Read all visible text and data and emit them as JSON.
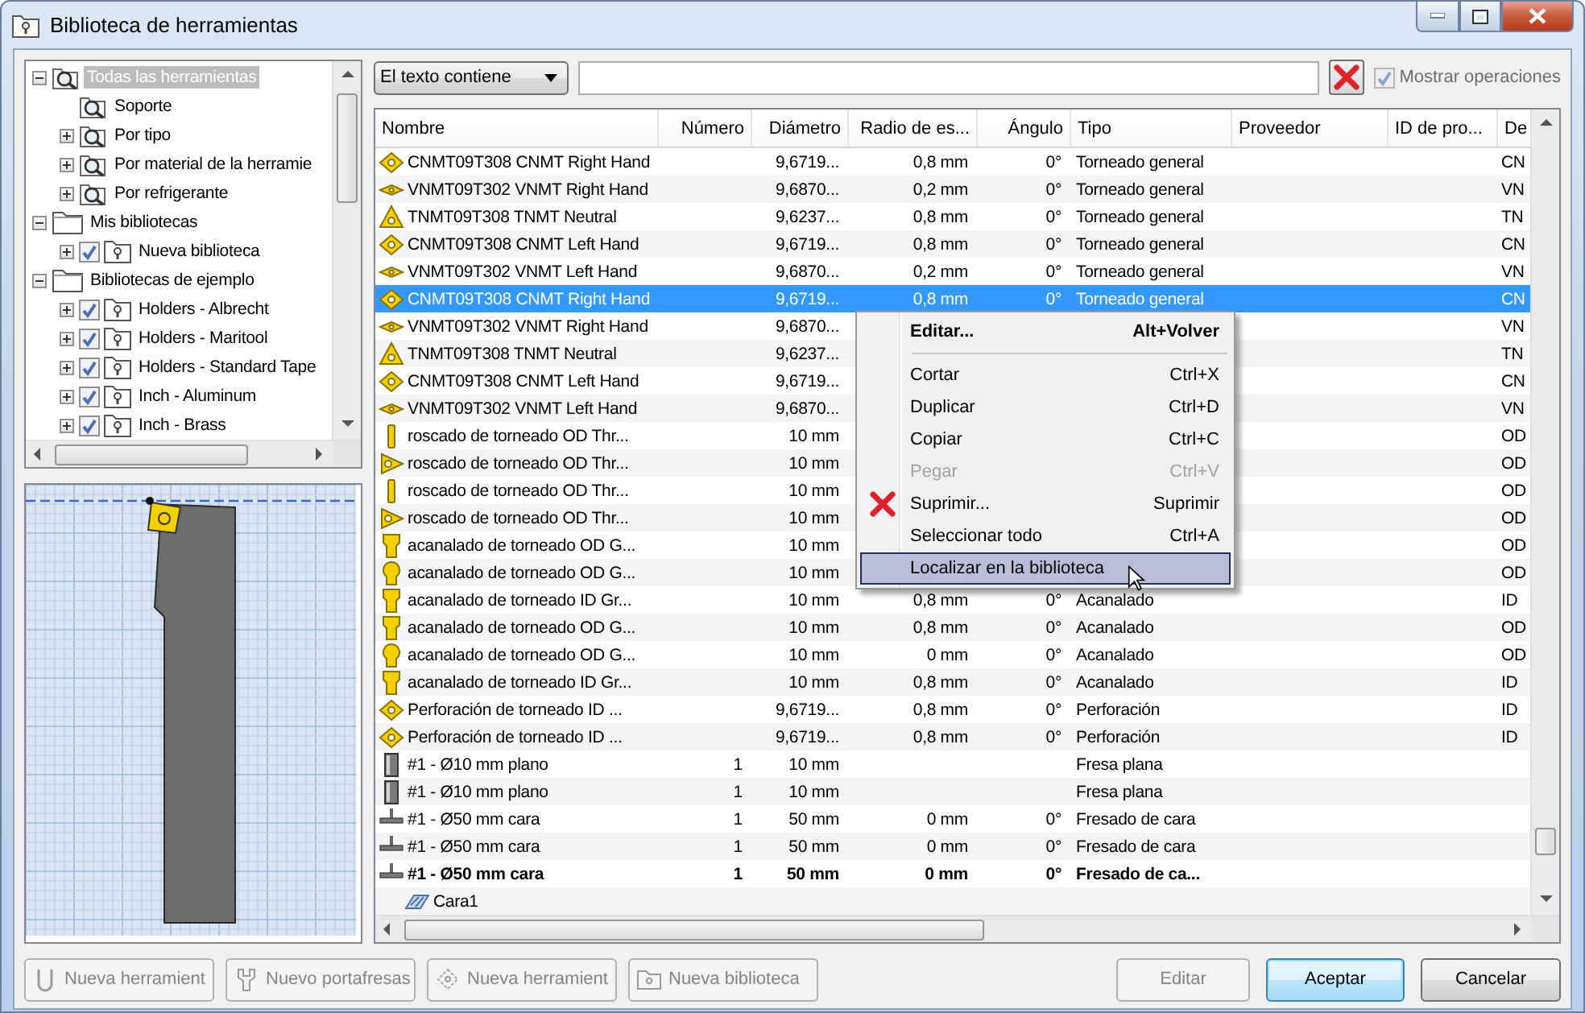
{
  "window": {
    "title": "Biblioteca de herramientas"
  },
  "tree": {
    "items": [
      {
        "label": "Todas las herramientas",
        "kind": "search",
        "selected": true,
        "expanded": true,
        "children": [
          {
            "label": "Soporte",
            "kind": "search",
            "selected": false
          },
          {
            "label": "Por tipo",
            "kind": "search",
            "selected": false,
            "expanded": false
          },
          {
            "label": "Por material de la herramie",
            "kind": "search",
            "selected": false,
            "expanded": false
          },
          {
            "label": "Por refrigerante",
            "kind": "search",
            "selected": false,
            "expanded": false
          }
        ]
      },
      {
        "label": "Mis bibliotecas",
        "kind": "folder",
        "selected": false,
        "expanded": true,
        "children": [
          {
            "label": "Nueva biblioteca",
            "kind": "library",
            "selected": false,
            "expanded": false,
            "checked": true
          }
        ]
      },
      {
        "label": "Bibliotecas de ejemplo",
        "kind": "folder",
        "selected": false,
        "expanded": true,
        "children": [
          {
            "label": "Holders - Albrecht",
            "kind": "library",
            "selected": false,
            "expanded": false,
            "checked": true
          },
          {
            "label": "Holders - Maritool",
            "kind": "library",
            "selected": false,
            "expanded": false,
            "checked": true
          },
          {
            "label": "Holders - Standard Tape",
            "kind": "library",
            "selected": false,
            "expanded": false,
            "checked": true
          },
          {
            "label": "Inch - Aluminum",
            "kind": "library",
            "selected": false,
            "expanded": false,
            "checked": true
          },
          {
            "label": "Inch - Brass",
            "kind": "library",
            "selected": false,
            "expanded": false,
            "checked": true
          }
        ]
      }
    ]
  },
  "filter": {
    "mode": "El texto contiene",
    "show_operations": {
      "label": "Mostrar operaciones",
      "checked": true,
      "disabled": true
    }
  },
  "table": {
    "columns": [
      "Nombre",
      "Número",
      "Diámetro",
      "Radio de es...",
      "Ángulo",
      "Tipo",
      "Proveedor",
      "ID de pro...",
      "De"
    ],
    "rows": [
      {
        "kind": "diamond",
        "selected": false,
        "bold": false,
        "cells": [
          "CNMT09T308 CNMT Right Hand",
          null,
          "9,6719...",
          "0,8 mm",
          "0°",
          "Torneado general",
          null,
          null,
          "CN"
        ]
      },
      {
        "kind": "eye",
        "selected": false,
        "bold": false,
        "cells": [
          "VNMT09T302 VNMT Right Hand",
          null,
          "9,6870...",
          "0,2 mm",
          "0°",
          "Torneado general",
          null,
          null,
          "VN"
        ]
      },
      {
        "kind": "triangle",
        "selected": false,
        "bold": false,
        "cells": [
          "TNMT09T308 TNMT Neutral",
          null,
          "9,6237...",
          "0,8 mm",
          "0°",
          "Torneado general",
          null,
          null,
          "TN"
        ]
      },
      {
        "kind": "diamond",
        "selected": false,
        "bold": false,
        "cells": [
          "CNMT09T308 CNMT Left Hand",
          null,
          "9,6719...",
          "0,8 mm",
          "0°",
          "Torneado general",
          null,
          null,
          "CN"
        ]
      },
      {
        "kind": "eye",
        "selected": false,
        "bold": false,
        "cells": [
          "VNMT09T302 VNMT Left Hand",
          null,
          "9,6870...",
          "0,2 mm",
          "0°",
          "Torneado general",
          null,
          null,
          "VN"
        ]
      },
      {
        "kind": "diamond",
        "selected": true,
        "bold": false,
        "cells": [
          "CNMT09T308 CNMT Right Hand",
          null,
          "9,6719...",
          "0,8 mm",
          "0°",
          "Torneado general",
          null,
          null,
          "CN"
        ]
      },
      {
        "kind": "eye",
        "selected": false,
        "bold": false,
        "cells": [
          "VNMT09T302 VNMT Right Hand",
          null,
          "9,6870...",
          null,
          null,
          null,
          null,
          null,
          "VN"
        ]
      },
      {
        "kind": "triangle",
        "selected": false,
        "bold": false,
        "cells": [
          "TNMT09T308 TNMT Neutral",
          null,
          "9,6237...",
          null,
          null,
          null,
          null,
          null,
          "TN"
        ]
      },
      {
        "kind": "diamond",
        "selected": false,
        "bold": false,
        "cells": [
          "CNMT09T308 CNMT Left Hand",
          null,
          "9,6719...",
          null,
          null,
          null,
          null,
          null,
          "CN"
        ]
      },
      {
        "kind": "eye",
        "selected": false,
        "bold": false,
        "cells": [
          "VNMT09T302 VNMT Left Hand",
          null,
          "9,6870...",
          null,
          null,
          null,
          null,
          null,
          "VN"
        ]
      },
      {
        "kind": "thread-bar",
        "selected": false,
        "bold": false,
        "cells": [
          "roscado de torneado OD Thr...",
          null,
          "10 mm",
          null,
          null,
          null,
          null,
          null,
          "OD"
        ]
      },
      {
        "kind": "thread-tri",
        "selected": false,
        "bold": false,
        "cells": [
          "roscado de torneado OD Thr...",
          null,
          "10 mm",
          null,
          null,
          null,
          null,
          null,
          "OD"
        ]
      },
      {
        "kind": "thread-bar",
        "selected": false,
        "bold": false,
        "cells": [
          "roscado de torneado OD Thr...",
          null,
          "10 mm",
          null,
          null,
          null,
          null,
          null,
          "OD"
        ]
      },
      {
        "kind": "thread-tri",
        "selected": false,
        "bold": false,
        "cells": [
          "roscado de torneado OD Thr...",
          null,
          "10 mm",
          null,
          null,
          null,
          null,
          null,
          "OD"
        ]
      },
      {
        "kind": "groove",
        "selected": false,
        "bold": false,
        "cells": [
          "acanalado de torneado OD G...",
          null,
          "10 mm",
          null,
          null,
          null,
          null,
          null,
          "OD"
        ]
      },
      {
        "kind": "groove-round",
        "selected": false,
        "bold": false,
        "cells": [
          "acanalado de torneado OD G...",
          null,
          "10 mm",
          null,
          null,
          null,
          null,
          null,
          "OD"
        ]
      },
      {
        "kind": "groove",
        "selected": false,
        "bold": false,
        "cells": [
          "acanalado de torneado ID Gr...",
          null,
          "10 mm",
          "0,8 mm",
          "0°",
          "Acanalado",
          null,
          null,
          "ID"
        ]
      },
      {
        "kind": "groove",
        "selected": false,
        "bold": false,
        "cells": [
          "acanalado de torneado OD G...",
          null,
          "10 mm",
          "0,8 mm",
          "0°",
          "Acanalado",
          null,
          null,
          "OD"
        ]
      },
      {
        "kind": "groove-round",
        "selected": false,
        "bold": false,
        "cells": [
          "acanalado de torneado OD G...",
          null,
          "10 mm",
          "0 mm",
          "0°",
          "Acanalado",
          null,
          null,
          "OD"
        ]
      },
      {
        "kind": "groove",
        "selected": false,
        "bold": false,
        "cells": [
          "acanalado de torneado ID Gr...",
          null,
          "10 mm",
          "0,8 mm",
          "0°",
          "Acanalado",
          null,
          null,
          "ID"
        ]
      },
      {
        "kind": "diamond",
        "selected": false,
        "bold": false,
        "cells": [
          "Perforación de torneado ID ...",
          null,
          "9,6719...",
          "0,8 mm",
          "0°",
          "Perforación",
          null,
          null,
          "ID"
        ]
      },
      {
        "kind": "diamond",
        "selected": false,
        "bold": false,
        "cells": [
          "Perforación de torneado ID ...",
          null,
          "9,6719...",
          "0,8 mm",
          "0°",
          "Perforación",
          null,
          null,
          "ID"
        ]
      },
      {
        "kind": "endmill",
        "selected": false,
        "bold": false,
        "cells": [
          "#1 - Ø10 mm plano",
          "1",
          "10 mm",
          null,
          null,
          "Fresa plana",
          null,
          null,
          null
        ]
      },
      {
        "kind": "endmill",
        "selected": false,
        "bold": false,
        "cells": [
          "#1 - Ø10 mm plano",
          "1",
          "10 mm",
          null,
          null,
          "Fresa plana",
          null,
          null,
          null
        ]
      },
      {
        "kind": "facemill",
        "selected": false,
        "bold": false,
        "cells": [
          "#1 - Ø50 mm cara",
          "1",
          "50 mm",
          "0 mm",
          "0°",
          "Fresado de cara",
          null,
          null,
          null
        ]
      },
      {
        "kind": "facemill",
        "selected": false,
        "bold": false,
        "cells": [
          "#1 - Ø50 mm cara",
          "1",
          "50 mm",
          "0 mm",
          "0°",
          "Fresado de cara",
          null,
          null,
          null
        ]
      },
      {
        "kind": "facemill",
        "selected": false,
        "bold": true,
        "cells": [
          "#1 - Ø50 mm cara",
          "1",
          "50 mm",
          "0 mm",
          "0°",
          "Fresado de ca...",
          null,
          null,
          null
        ],
        "children": [
          {
            "kind": "face",
            "selected": false,
            "bold": false,
            "cells": [
              "Cara1"
            ]
          }
        ]
      }
    ]
  },
  "context_menu": {
    "items": [
      {
        "kind": "default",
        "label": "Editar...",
        "shortcut": "Alt+Volver",
        "disabled": false,
        "selected": false
      },
      {
        "kind": "separator"
      },
      {
        "kind": "item",
        "label": "Cortar",
        "shortcut": "Ctrl+X",
        "disabled": false,
        "selected": false
      },
      {
        "kind": "item",
        "label": "Duplicar",
        "shortcut": "Ctrl+D",
        "disabled": false,
        "selected": false
      },
      {
        "kind": "item",
        "label": "Copiar",
        "shortcut": "Ctrl+C",
        "disabled": false,
        "selected": false
      },
      {
        "kind": "item",
        "label": "Pegar",
        "shortcut": "Ctrl+V",
        "disabled": true,
        "selected": false
      },
      {
        "kind": "delete",
        "label": "Suprimir...",
        "shortcut": "Suprimir",
        "disabled": false,
        "selected": false
      },
      {
        "kind": "item",
        "label": "Seleccionar todo",
        "shortcut": "Ctrl+A",
        "disabled": false,
        "selected": false
      },
      {
        "kind": "item",
        "label": "Localizar en la biblioteca",
        "disabled": false,
        "selected": true
      }
    ]
  },
  "tool_buttons": [
    {
      "kind": "tool",
      "label": "Nueva herramient",
      "disabled": true
    },
    {
      "kind": "holder",
      "label": "Nuevo portafresas",
      "disabled": true
    },
    {
      "kind": "insert",
      "label": "Nueva herramient",
      "disabled": true
    },
    {
      "kind": "library",
      "label": "Nueva biblioteca",
      "disabled": true
    }
  ],
  "dialog_buttons": [
    {
      "label": "Editar",
      "disabled": true,
      "default": false
    },
    {
      "label": "Aceptar",
      "disabled": false,
      "default": true
    },
    {
      "label": "Cancelar",
      "disabled": false,
      "default": false
    }
  ]
}
